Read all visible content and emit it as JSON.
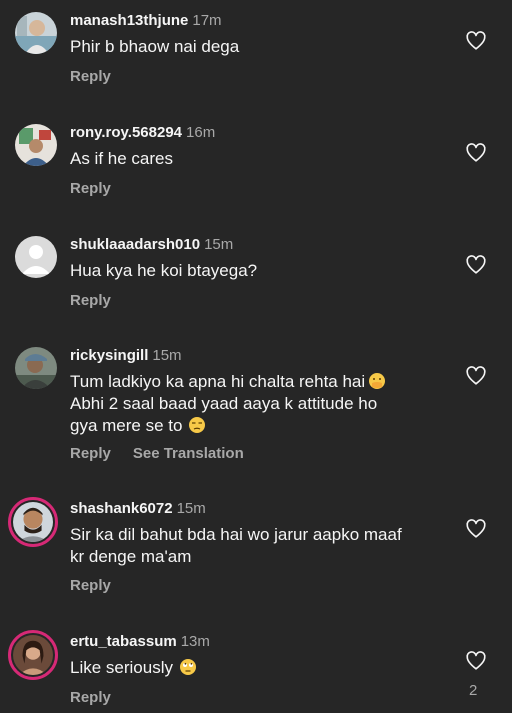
{
  "comments": [
    {
      "username": "manash13thjune",
      "time": "17m",
      "text": "Phir b bhaow nai dega",
      "actions": [
        "Reply"
      ],
      "avatar": "photo-avatar",
      "liked": false
    },
    {
      "username": "rony.roy.568294",
      "time": "16m",
      "text": "As if he cares",
      "actions": [
        "Reply"
      ],
      "avatar": "photo-avatar",
      "liked": false
    },
    {
      "username": "shuklaaadarsh010",
      "time": "15m",
      "text": "Hua kya he koi btayega?",
      "actions": [
        "Reply"
      ],
      "avatar": "default-avatar",
      "liked": false
    },
    {
      "username": "rickysingill",
      "time": "15m",
      "text_lines": [
        "Tum ladkiyo ka apna hi chalta rehta hai",
        "Abhi 2 saal baad yaad aaya k attitude ho",
        "gya mere se to"
      ],
      "emojis": [
        "hand-over-mouth-emoji",
        "unamused-face-emoji"
      ],
      "actions": [
        "Reply",
        "See Translation"
      ],
      "avatar": "photo-avatar",
      "liked": false
    },
    {
      "username": "shashank6072",
      "time": "15m",
      "text_lines": [
        "Sir ka dil bahut bda hai wo jarur aapko maaf",
        "kr denge ma'am"
      ],
      "actions": [
        "Reply"
      ],
      "avatar": "story-ring-avatar",
      "liked": false
    },
    {
      "username": "ertu_tabassum",
      "time": "13m",
      "text": "Like seriously",
      "emojis": [
        "eye-roll-emoji"
      ],
      "actions": [
        "Reply"
      ],
      "avatar": "story-ring-avatar",
      "liked": false,
      "like_count": "2"
    }
  ],
  "colors": {
    "background": "#262626",
    "primary_text": "#f5f5f5",
    "secondary_text": "#a8a8a8",
    "story_ring": "#d62976"
  }
}
